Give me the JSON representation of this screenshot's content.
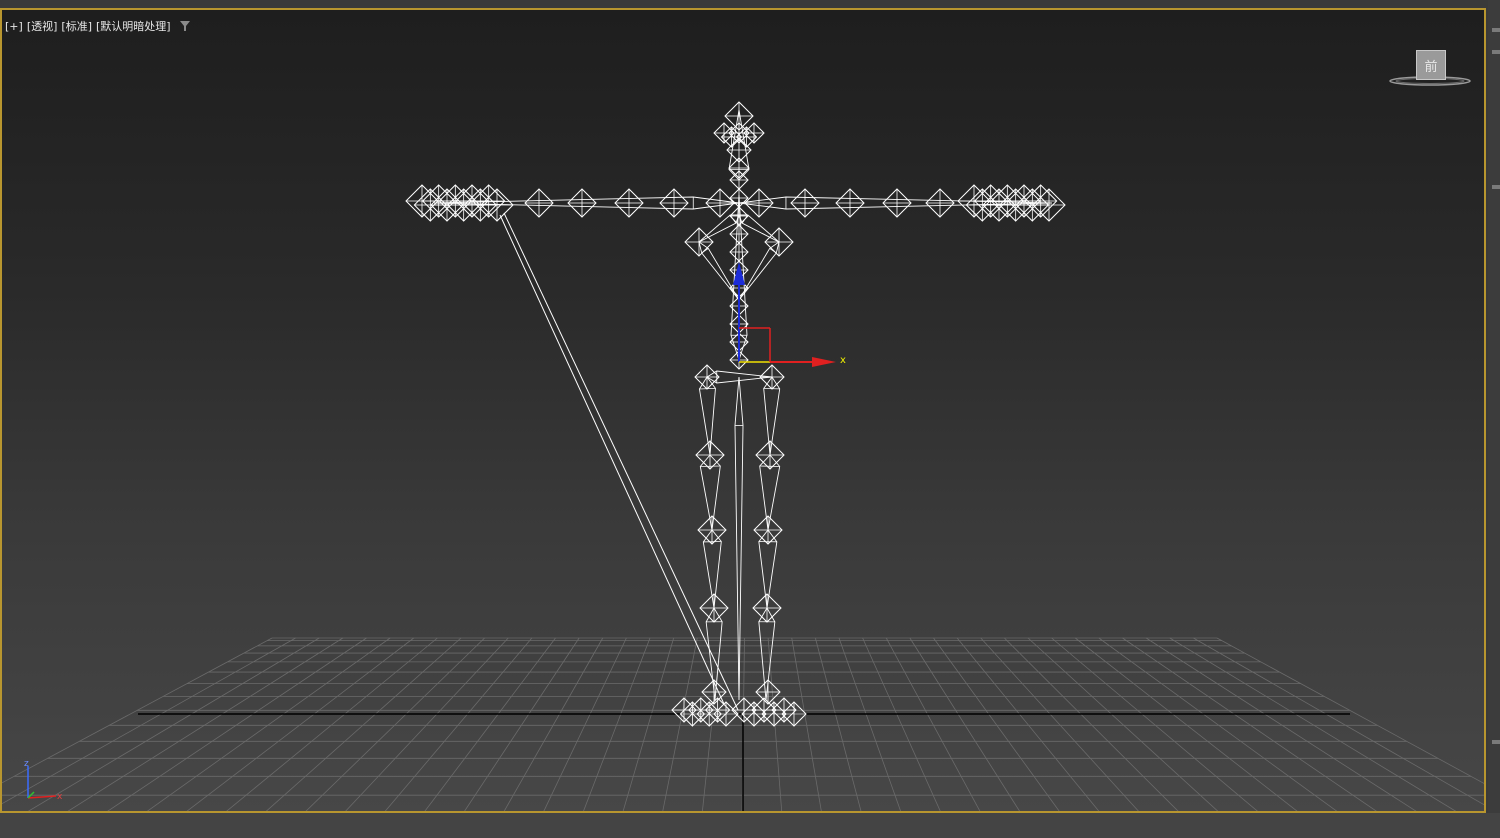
{
  "viewport": {
    "label_parts": [
      "[+]",
      "[透视]",
      "[标准]",
      "[默认明暗处理]"
    ],
    "filter_icon": "filter-icon"
  },
  "viewcube": {
    "face_label": "前",
    "icon": "viewcube-icon"
  },
  "gizmo": {
    "x_label": "x",
    "colors": {
      "x": "#e02020",
      "y": "#f0e000",
      "z": "#1c2cd8"
    }
  },
  "axis_tripod": {
    "icon": "world-axis-icon",
    "z_label": "z",
    "x_label": "x"
  },
  "colors": {
    "accent_border": "#b8962f",
    "wireframe": "#ffffff",
    "grid": "#6a6a6a"
  }
}
